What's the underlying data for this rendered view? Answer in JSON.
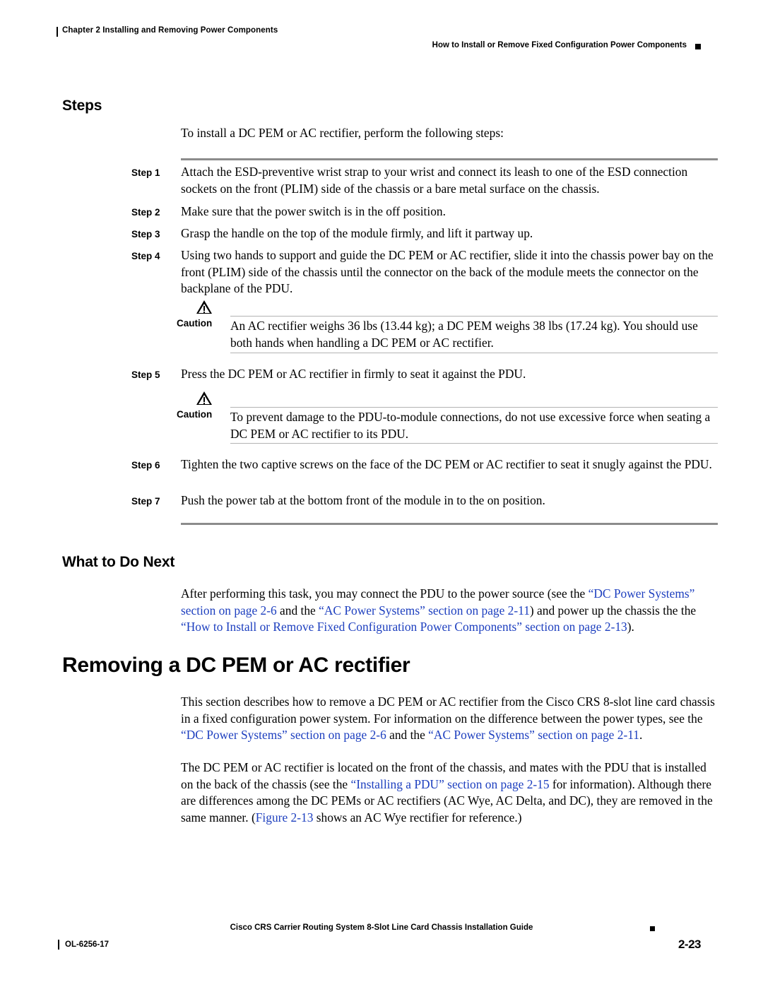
{
  "header": {
    "chapter": "Chapter 2      Installing and Removing Power Components",
    "section": "How to Install or Remove Fixed Configuration Power Components"
  },
  "sections": {
    "steps_heading": "Steps",
    "steps_intro": "To install a DC PEM or AC rectifier, perform the following steps:",
    "steps": [
      {
        "label": "Step 1",
        "text": "Attach the ESD-preventive wrist strap to your wrist and connect its leash to one of the ESD connection sockets on the front (PLIM) side of the chassis or a bare metal surface on the chassis."
      },
      {
        "label": "Step 2",
        "text": "Make sure that the power switch is in the off position."
      },
      {
        "label": "Step 3",
        "text": "Grasp the handle on the top of the module firmly, and lift it partway up."
      },
      {
        "label": "Step 4",
        "text": "Using two hands to support and guide the DC PEM or AC rectifier, slide it into the chassis power bay on the front (PLIM) side of the chassis until the connector on the back of the module meets the connector on the backplane of the PDU."
      },
      {
        "label": "Step 5",
        "text": "Press the DC PEM or AC rectifier in firmly to seat it against the PDU."
      },
      {
        "label": "Step 6",
        "text": "Tighten the two captive screws on the face of the DC PEM or AC rectifier to seat it snugly against the PDU."
      },
      {
        "label": "Step 7",
        "text": "Push the power tab at the bottom front of the module in to the on position."
      }
    ],
    "caution1": {
      "label": "Caution",
      "text": "An AC rectifier weighs 36 lbs (13.44 kg); a DC PEM weighs 38 lbs (17.24 kg). You should use both hands when handling a DC PEM or AC rectifier."
    },
    "caution2": {
      "label": "Caution",
      "text": "To prevent damage to the PDU-to-module connections, do not use excessive force when seating a DC PEM or AC rectifier to its PDU."
    },
    "what_next_heading": "What to Do Next",
    "what_next": {
      "part1": "After performing this task, you may connect the PDU to the power source (see the ",
      "link1": "“DC Power Systems” section on page 2-6",
      "part2": " and the ",
      "link2": "“AC Power Systems” section on page 2-11",
      "part3": ") and power up the chassis the the ",
      "link3": "“How to Install or Remove Fixed Configuration Power Components” section on page 2-13",
      "part4": ")."
    },
    "removing_heading": "Removing a DC PEM or AC rectifier",
    "removing_p1": {
      "part1": "This section describes how to remove a DC PEM or AC rectifier from the Cisco CRS 8-slot line card chassis in a fixed configuration power system. For information on the difference between the power types, see the ",
      "link1": "“DC Power Systems” section on page 2-6",
      "part2": " and the ",
      "link2": "“AC Power Systems” section on page 2-11",
      "part3": "."
    },
    "removing_p2": {
      "part1": "The DC PEM or AC rectifier is located on the front of the chassis, and mates with the PDU that is installed on the back of the chassis (see the ",
      "link1": "“Installing a PDU” section on page 2-15",
      "part2": " for information). Although there are differences among the DC PEMs or AC rectifiers (AC Wye, AC Delta, and DC), they are removed in the same manner. (",
      "link2": "Figure 2-13",
      "part3": " shows an AC Wye rectifier for reference.)"
    }
  },
  "footer": {
    "title": "Cisco CRS Carrier Routing System 8-Slot Line Card Chassis Installation Guide",
    "doc_number": "OL-6256-17",
    "page_number": "2-23"
  },
  "colors": {
    "link": "#1d3fbf",
    "rule": "#8c8c8c"
  }
}
